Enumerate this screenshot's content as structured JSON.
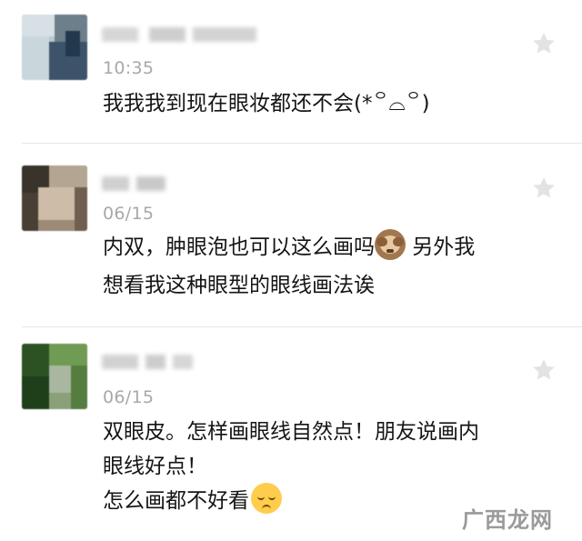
{
  "comments": [
    {
      "time": "10:35",
      "lines": [
        "我我我到现在眼妆都还不会(*꒪⌓꒪)"
      ]
    },
    {
      "time": "06/15",
      "line1_before": "内双，肿眼泡也可以这么画吗",
      "line1_emoji": "see-no-evil-monkey-emoji",
      "line1_after": " 另外我",
      "line2": "想看我这种眼型的眼线画法诶"
    },
    {
      "time": "06/15",
      "line1": "双眼皮。怎样画眼线自然点！朋友说画内",
      "line2": "眼线好点！",
      "line3_before": "怎么画都不好看",
      "line3_emoji": "pensive-face-emoji"
    }
  ],
  "watermark": "广西龙网",
  "colors": {
    "background": "#ffffff",
    "date": "#a8a8a8",
    "text": "#151515",
    "divider": "#e6e6e6",
    "star": "#e3e3e3"
  }
}
